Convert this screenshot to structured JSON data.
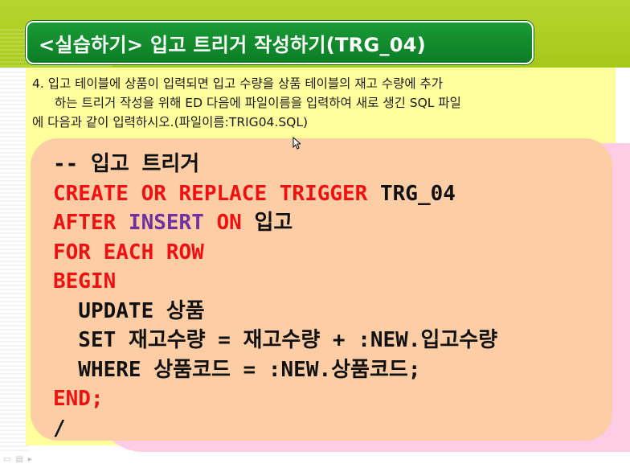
{
  "slide": {
    "title": "<실습하기> 입고 트리거 작성하기(TRG_04)",
    "instructions": {
      "line1": "4. 입고 테이블에 상품이 입력되면 입고 수량을 상품 테이블의 재고 수량에 추가",
      "line2": "하는 트리거 작성을 위해 ED 다음에 파일이름을 입력하여 새로 생긴 SQL 파일",
      "line3": "에 다음과 같이 입력하시오.(파일이름:TRIG04.SQL)"
    },
    "code": {
      "l1": "-- 입고 트리거",
      "l2_kw": "CREATE OR REPLACE TRIGGER",
      "l2_rest": " TRG_04",
      "l3_after": "AFTER ",
      "l3_insert": "INSERT",
      "l3_on": " ON",
      "l3_table": " 입고",
      "l4": "FOR EACH ROW",
      "l5": "BEGIN",
      "l6": "  UPDATE 상품",
      "l7": "  SET 재고수량 = 재고수량 + :NEW.입고수량",
      "l8": "  WHERE 상품코드 = :NEW.상품코드;",
      "l9": "END;",
      "l10": "/"
    }
  },
  "colors": {
    "title_bg": "#0c7d25",
    "keyword_red": "#ee1111",
    "keyword_purple": "#7030a0",
    "code_bg": "#fdcea6",
    "panel_bg": "#fefe9c",
    "band_pink": "#ffcce6",
    "band_lime": "#a6c81a"
  },
  "icons": {
    "cursor": "arrow-cursor-icon",
    "status": [
      "slide-view-icon",
      "outline-view-icon",
      "slideshow-icon"
    ]
  }
}
